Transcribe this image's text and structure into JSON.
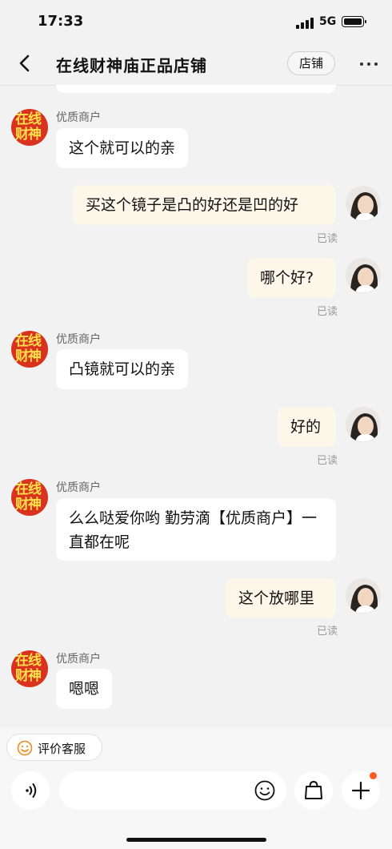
{
  "status_bar": {
    "time": "17:33",
    "network": "5G"
  },
  "header": {
    "title": "在线财神庙正品店铺",
    "shop_button": "店铺"
  },
  "shop_avatar": {
    "line1": "在线",
    "line2": "财神"
  },
  "read_label": "已读",
  "messages": [
    {
      "sender": "优质商户",
      "text": "这个就可以的亲"
    },
    {
      "text": "买这个镜子是凸的好还是凹的好"
    },
    {
      "text": "哪个好?"
    },
    {
      "sender": "优质商户",
      "text": "凸镜就可以的亲"
    },
    {
      "text": "好的"
    },
    {
      "sender": "优质商户",
      "text": "么么哒爱你哟  勤劳滴【优质商户】一直都在呢"
    },
    {
      "text": "这个放哪里"
    },
    {
      "sender": "优质商户",
      "text": "嗯嗯"
    }
  ],
  "bottom": {
    "rate_label": "评价客服",
    "input_placeholder": ""
  },
  "icons": [
    "back-icon",
    "more-icon",
    "voice-icon",
    "emoji-icon",
    "bag-icon",
    "plus-icon",
    "smile-icon"
  ],
  "colors": {
    "shop_avatar_bg": "#d9321f",
    "shop_avatar_text": "#ffe14a",
    "outgoing_bubble": "#fcf7e8",
    "badge": "#ff5a1f"
  }
}
